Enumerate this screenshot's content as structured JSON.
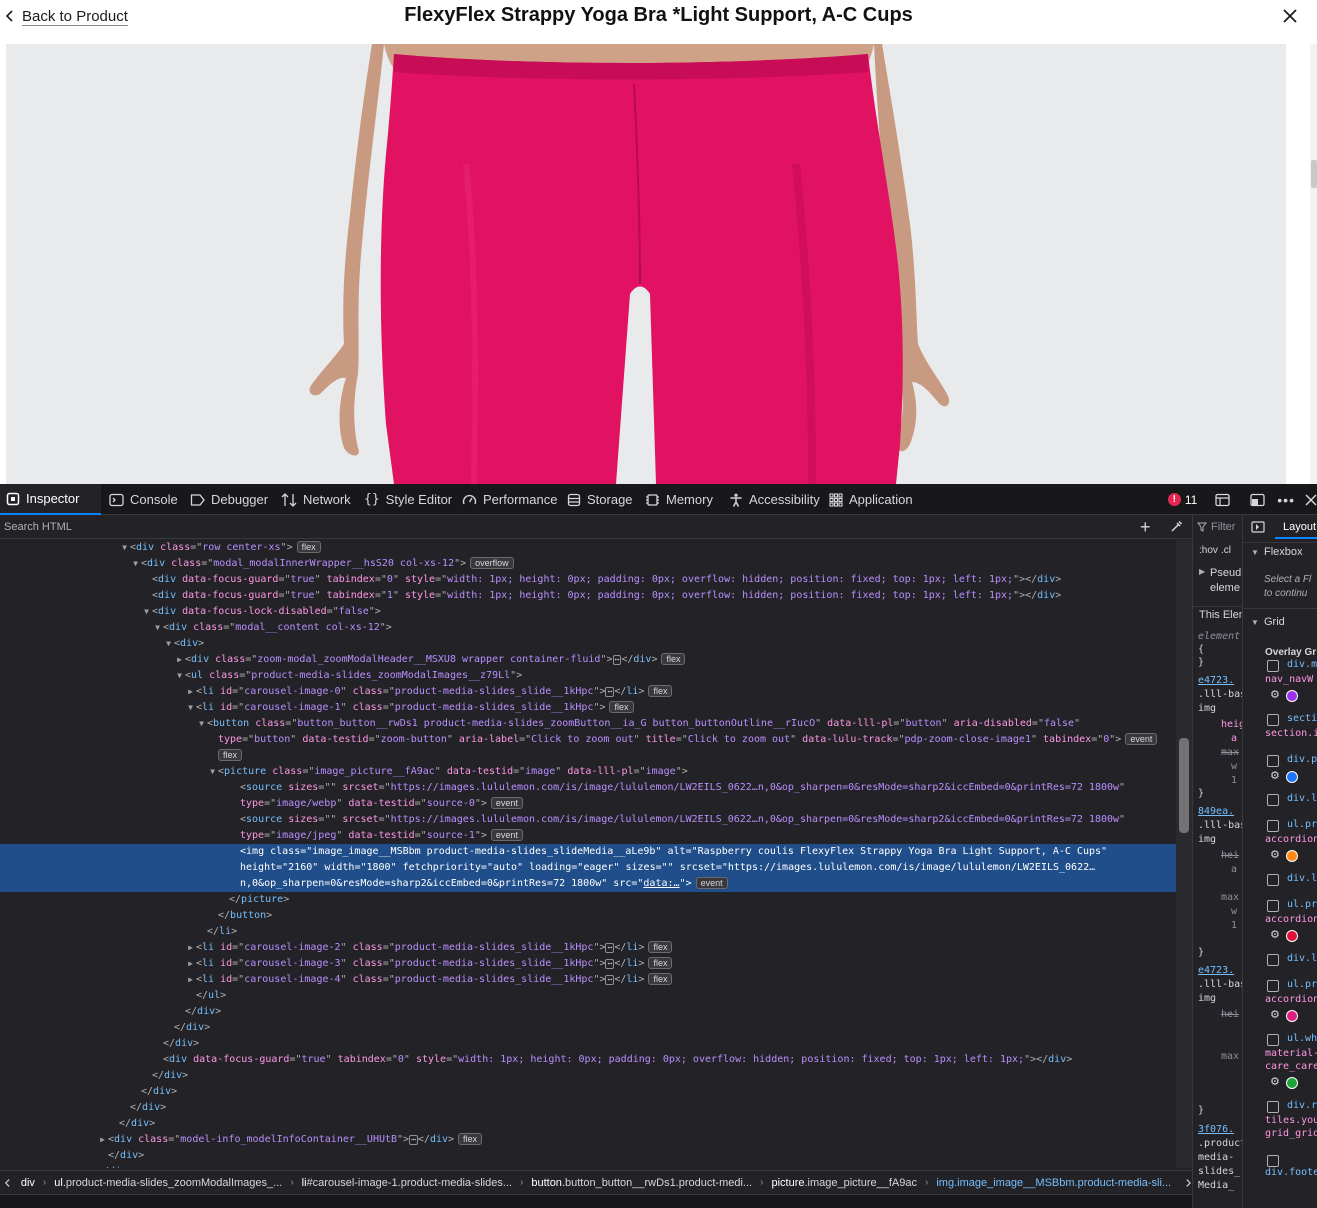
{
  "modal": {
    "back_label": "Back to Product",
    "title": "FlexyFlex Strappy Yoga Bra *Light Support, A-C Cups"
  },
  "devtools": {
    "tabs": [
      {
        "label": "Inspector",
        "icon": "inspector-icon",
        "active": true
      },
      {
        "label": "Console",
        "icon": "console-icon"
      },
      {
        "label": "Debugger",
        "icon": "debugger-icon"
      },
      {
        "label": "Network",
        "icon": "network-icon"
      },
      {
        "label": "Style Editor",
        "icon": "style-editor-icon"
      },
      {
        "label": "Performance",
        "icon": "performance-icon"
      },
      {
        "label": "Storage",
        "icon": "storage-icon"
      },
      {
        "label": "Memory",
        "icon": "memory-icon"
      },
      {
        "label": "Accessibility",
        "icon": "accessibility-icon"
      },
      {
        "label": "Application",
        "icon": "application-icon"
      }
    ],
    "error_count": "11",
    "search_placeholder": "Search HTML",
    "breadcrumbs": [
      {
        "tag": "div",
        "rest": ""
      },
      {
        "tag": "ul",
        "rest": ".product-media-slides_zoomModalImages_..."
      },
      {
        "tag": "li",
        "rest": "#carousel-image-1.product-media-slides..."
      },
      {
        "tag": "button",
        "rest": ".button_button__rwDs1.product-medi..."
      },
      {
        "tag": "picture",
        "rest": ".image_picture__fA9ac"
      },
      {
        "tag": "img",
        "rest": ".image_image__MSBbm.product-media-sli..."
      }
    ],
    "rules": {
      "filter_label": "Filter",
      "hov": ":hov",
      "cls": ".cl",
      "pseudo1": "Pseud",
      "pseudo2": "eleme",
      "this_element": "This Elem",
      "element_label": "element",
      "open_brace": "{",
      "close_brace": "}",
      "link1": "e4723.",
      "sel1a": ".lll-bas",
      "sel1b": "img",
      "p_heig": "heig",
      "p_a": "a",
      "p_max": "max",
      "p_w": "w",
      "p_1": "1",
      "link2": "849ea.",
      "sel2a": ".lll-bas",
      "sel2b": "img",
      "p_hei": "hei",
      "link3": "e4723.",
      "sel3a": ".lll-bas",
      "sel3b": "img",
      "link4": "3f076.",
      "sel4a": ".product",
      "sel4b": "media-",
      "sel4c": "slides_",
      "sel4d": "Media_"
    },
    "layout": {
      "tab_label": "Layout",
      "flexbox_label": "Flexbox",
      "flexbox_hint1": "Select a Fl",
      "flexbox_hint2": "to continu",
      "grid_label": "Grid",
      "overlay_label": "Overlay Gr",
      "grids": [
        {
          "name": "div.m",
          "sub": "nav_navW",
          "color": "#9b30f0"
        },
        {
          "name": "secti",
          "sub": "section.i",
          "color": ""
        },
        {
          "name": "div.p",
          "sub": "",
          "color": "#1f75ff"
        },
        {
          "name": "div.l",
          "sub": "",
          "color": ""
        },
        {
          "name": "ul.pr",
          "sub": "accordion",
          "color": "#ff8a1a"
        },
        {
          "name": "div.l",
          "sub": "",
          "color": ""
        },
        {
          "name": "ul.pr",
          "sub": "accordion",
          "color": "#e0123a"
        },
        {
          "name": "div.l",
          "sub": "",
          "color": ""
        },
        {
          "name": "ul.pr",
          "sub": "accordion",
          "color": "#e0207e"
        },
        {
          "name": "ul.wh",
          "sub": "material-",
          "sub2": "care_care",
          "color": "#1fa33a"
        },
        {
          "name": "div.r",
          "sub": "tiles.you",
          "sub2": "grid_grid",
          "color": ""
        },
        {
          "name": "",
          "sub": "div.foote",
          "color": ""
        }
      ]
    },
    "markup_lines": [
      {
        "indent": 130,
        "tw": "open",
        "html": "<span class='pun'>&lt;</span><span class='tg'>div</span> <span class='an'>class</span><span class='pun'>=\"</span><span class='av'>row center-xs</span><span class='pun'>\"&gt;</span><span class='badge'>flex</span>"
      },
      {
        "indent": 141,
        "tw": "open",
        "html": "<span class='pun'>&lt;</span><span class='tg'>div</span> <span class='an'>class</span><span class='pun'>=\"</span><span class='av'>modal_modalInnerWrapper__hsS20 col-xs-12</span><span class='pun'>\"&gt;</span><span class='badge'>overflow</span>"
      },
      {
        "indent": 152,
        "tw": "",
        "html": "<span class='pun'>&lt;</span><span class='tg'>div</span> <span class='an'>data-focus-guard</span><span class='pun'>=\"</span><span class='av'>true</span><span class='pun'>\"</span> <span class='an'>tabindex</span><span class='pun'>=\"</span><span class='av'>0</span><span class='pun'>\"</span> <span class='an'>style</span><span class='pun'>=\"</span><span class='av'>width: 1px; height: 0px; padding: 0px; overflow: hidden; position: fixed; top: 1px; left: 1px;</span><span class='pun'>\"&gt;&lt;/</span><span class='tg'>div</span><span class='pun'>&gt;</span>"
      },
      {
        "indent": 152,
        "tw": "",
        "html": "<span class='pun'>&lt;</span><span class='tg'>div</span> <span class='an'>data-focus-guard</span><span class='pun'>=\"</span><span class='av'>true</span><span class='pun'>\"</span> <span class='an'>tabindex</span><span class='pun'>=\"</span><span class='av'>1</span><span class='pun'>\"</span> <span class='an'>style</span><span class='pun'>=\"</span><span class='av'>width: 1px; height: 0px; padding: 0px; overflow: hidden; position: fixed; top: 1px; left: 1px;</span><span class='pun'>\"&gt;&lt;/</span><span class='tg'>div</span><span class='pun'>&gt;</span>"
      },
      {
        "indent": 152,
        "tw": "open",
        "html": "<span class='pun'>&lt;</span><span class='tg'>div</span> <span class='an'>data-focus-lock-disabled</span><span class='pun'>=\"</span><span class='av'>false</span><span class='pun'>\"&gt;</span>"
      },
      {
        "indent": 163,
        "tw": "open",
        "html": "<span class='pun'>&lt;</span><span class='tg'>div</span> <span class='an'>class</span><span class='pun'>=\"</span><span class='av'>modal__content col-xs-12</span><span class='pun'>\"&gt;</span>"
      },
      {
        "indent": 174,
        "tw": "open",
        "html": "<span class='pun'>&lt;</span><span class='tg'>div</span><span class='pun'>&gt;</span>"
      },
      {
        "indent": 185,
        "tw": "closed",
        "html": "<span class='pun'>&lt;</span><span class='tg'>div</span> <span class='an'>class</span><span class='pun'>=\"</span><span class='av'>zoom-modal_zoomModalHeader__MSXU8 wrapper container-fluid</span><span class='pun'>\"&gt;</span><span class='ell'>⋯</span><span class='pun'>&lt;/</span><span class='tg'>div</span><span class='pun'>&gt;</span><span class='badge'>flex</span>"
      },
      {
        "indent": 185,
        "tw": "open",
        "html": "<span class='pun'>&lt;</span><span class='tg'>ul</span> <span class='an'>class</span><span class='pun'>=\"</span><span class='av'>product-media-slides_zoomModalImages__z79Ll</span><span class='pun'>\"&gt;</span>"
      },
      {
        "indent": 196,
        "tw": "closed",
        "html": "<span class='pun'>&lt;</span><span class='tg'>li</span> <span class='an'>id</span><span class='pun'>=\"</span><span class='av'>carousel-image-0</span><span class='pun'>\"</span> <span class='an'>class</span><span class='pun'>=\"</span><span class='av'>product-media-slides_slide__1kHpc</span><span class='pun'>\"&gt;</span><span class='ell'>⋯</span><span class='pun'>&lt;/</span><span class='tg'>li</span><span class='pun'>&gt;</span><span class='badge'>flex</span>"
      },
      {
        "indent": 196,
        "tw": "open",
        "html": "<span class='pun'>&lt;</span><span class='tg'>li</span> <span class='an'>id</span><span class='pun'>=\"</span><span class='av'>carousel-image-1</span><span class='pun'>\"</span> <span class='an'>class</span><span class='pun'>=\"</span><span class='av'>product-media-slides_slide__1kHpc</span><span class='pun'>\"&gt;</span><span class='badge'>flex</span>"
      },
      {
        "indent": 207,
        "tw": "open",
        "html": "<span class='pun'>&lt;</span><span class='tg'>button</span> <span class='an'>class</span><span class='pun'>=\"</span><span class='av'>button_button__rwDs1 product-media-slides_zoomButton__ia_G button_buttonOutline__rIucO</span><span class='pun'>\"</span> <span class='an'>data-lll-pl</span><span class='pun'>=\"</span><span class='av'>button</span><span class='pun'>\"</span> <span class='an'>aria-disabled</span><span class='pun'>=\"</span><span class='av'>false</span><span class='pun'>\"</span>"
      },
      {
        "indent": 218,
        "tw": "",
        "html": "<span class='an'>type</span><span class='pun'>=\"</span><span class='av'>button</span><span class='pun'>\"</span> <span class='an'>data-testid</span><span class='pun'>=\"</span><span class='av'>zoom-button</span><span class='pun'>\"</span> <span class='an'>aria-label</span><span class='pun'>=\"</span><span class='av'>Click to zoom out</span><span class='pun'>\"</span> <span class='an'>title</span><span class='pun'>=\"</span><span class='av'>Click to zoom out</span><span class='pun'>\"</span> <span class='an'>data-lulu-track</span><span class='pun'>=\"</span><span class='av'>pdp-zoom-close-image1</span><span class='pun'>\"</span> <span class='an'>tabindex</span><span class='pun'>=\"</span><span class='av'>0</span><span class='pun'>\"&gt;</span><span class='badge'>event</span>"
      },
      {
        "indent": 218,
        "tw": "",
        "html": "<span class='badge' style='margin-left:0'>flex</span>"
      },
      {
        "indent": 218,
        "tw": "open",
        "html": "<span class='pun'>&lt;</span><span class='tg'>picture</span> <span class='an'>class</span><span class='pun'>=\"</span><span class='av'>image_picture__fA9ac</span><span class='pun'>\"</span> <span class='an'>data-testid</span><span class='pun'>=\"</span><span class='av'>image</span><span class='pun'>\"</span> <span class='an'>data-lll-pl</span><span class='pun'>=\"</span><span class='av'>image</span><span class='pun'>\"&gt;</span>"
      },
      {
        "indent": 240,
        "tw": "",
        "html": "<span class='pun'>&lt;</span><span class='tg'>source</span> <span class='an'>sizes</span><span class='pun'>=\"\"</span> <span class='an'>srcset</span><span class='pun'>=\"</span><span class='av'>https://images.lululemon.com/is/image/lululemon/LW2EILS_0622…n,0&amp;op_sharpen=0&amp;resMode=sharp2&amp;iccEmbed=0&amp;printRes=72 1800w</span><span class='pun'>\"</span>"
      },
      {
        "indent": 240,
        "tw": "",
        "html": "<span class='an'>type</span><span class='pun'>=\"</span><span class='av'>image/webp</span><span class='pun'>\"</span> <span class='an'>data-testid</span><span class='pun'>=\"</span><span class='av'>source-0</span><span class='pun'>\"&gt;</span><span class='badge'>event</span>"
      },
      {
        "indent": 240,
        "tw": "",
        "html": "<span class='pun'>&lt;</span><span class='tg'>source</span> <span class='an'>sizes</span><span class='pun'>=\"\"</span> <span class='an'>srcset</span><span class='pun'>=\"</span><span class='av'>https://images.lululemon.com/is/image/lululemon/LW2EILS_0622…n,0&amp;op_sharpen=0&amp;resMode=sharp2&amp;iccEmbed=0&amp;printRes=72 1800w</span><span class='pun'>\"</span>"
      },
      {
        "indent": 240,
        "tw": "",
        "html": "<span class='an'>type</span><span class='pun'>=\"</span><span class='av'>image/jpeg</span><span class='pun'>\"</span> <span class='an'>data-testid</span><span class='pun'>=\"</span><span class='av'>source-1</span><span class='pun'>\"&gt;</span><span class='badge'>event</span>"
      },
      {
        "indent": 240,
        "tw": "",
        "sel": true,
        "html": "<span class='pun'>&lt;</span><span class='tg'>img</span> <span class='an'>class</span><span class='pun'>=\"</span><span class='av'>image_image__MSBbm product-media-slides_slideMedia__aLe9b</span><span class='pun'>\"</span> <span class='an'>alt</span><span class='pun'>=\"</span><span class='av'>Raspberry coulis FlexyFlex Strappy Yoga Bra Light Support, A-C Cups</span><span class='pun'>\"</span>"
      },
      {
        "indent": 240,
        "tw": "",
        "sel": true,
        "html": "<span class='an'>height</span><span class='pun'>=\"</span><span class='av'>2160</span><span class='pun'>\"</span> <span class='an'>width</span><span class='pun'>=\"</span><span class='av'>1800</span><span class='pun'>\"</span> <span class='an'>fetchpriority</span><span class='pun'>=\"</span><span class='av'>auto</span><span class='pun'>\"</span> <span class='an'>loading</span><span class='pun'>=\"</span><span class='av'>eager</span><span class='pun'>\"</span> <span class='an'>sizes</span><span class='pun'>=\"\"</span> <span class='an'>srcset</span><span class='pun'>=\"</span><span class='av'>https://images.lululemon.com/is/image/lululemon/LW2EILS_0622…</span>"
      },
      {
        "indent": 240,
        "tw": "",
        "sel": true,
        "html": "<span class='av'>n,0&amp;op_sharpen=0&amp;resMode=sharp2&amp;iccEmbed=0&amp;printRes=72 1800w</span><span class='pun'>\"</span> <span class='an'>src</span><span class='pun'>=\"</span><span class='av' style='text-decoration:underline'>data:…</span><span class='pun'>\"&gt;</span><span class='badge'>event</span>"
      },
      {
        "indent": 229,
        "tw": "",
        "html": "<span class='pun'>&lt;/</span><span class='tg'>picture</span><span class='pun'>&gt;</span>"
      },
      {
        "indent": 218,
        "tw": "",
        "html": "<span class='pun'>&lt;/</span><span class='tg'>button</span><span class='pun'>&gt;</span>"
      },
      {
        "indent": 207,
        "tw": "",
        "html": "<span class='pun'>&lt;/</span><span class='tg'>li</span><span class='pun'>&gt;</span>"
      },
      {
        "indent": 196,
        "tw": "closed",
        "html": "<span class='pun'>&lt;</span><span class='tg'>li</span> <span class='an'>id</span><span class='pun'>=\"</span><span class='av'>carousel-image-2</span><span class='pun'>\"</span> <span class='an'>class</span><span class='pun'>=\"</span><span class='av'>product-media-slides_slide__1kHpc</span><span class='pun'>\"&gt;</span><span class='ell'>⋯</span><span class='pun'>&lt;/</span><span class='tg'>li</span><span class='pun'>&gt;</span><span class='badge'>flex</span>"
      },
      {
        "indent": 196,
        "tw": "closed",
        "html": "<span class='pun'>&lt;</span><span class='tg'>li</span> <span class='an'>id</span><span class='pun'>=\"</span><span class='av'>carousel-image-3</span><span class='pun'>\"</span> <span class='an'>class</span><span class='pun'>=\"</span><span class='av'>product-media-slides_slide__1kHpc</span><span class='pun'>\"&gt;</span><span class='ell'>⋯</span><span class='pun'>&lt;/</span><span class='tg'>li</span><span class='pun'>&gt;</span><span class='badge'>flex</span>"
      },
      {
        "indent": 196,
        "tw": "closed",
        "html": "<span class='pun'>&lt;</span><span class='tg'>li</span> <span class='an'>id</span><span class='pun'>=\"</span><span class='av'>carousel-image-4</span><span class='pun'>\"</span> <span class='an'>class</span><span class='pun'>=\"</span><span class='av'>product-media-slides_slide__1kHpc</span><span class='pun'>\"&gt;</span><span class='ell'>⋯</span><span class='pun'>&lt;/</span><span class='tg'>li</span><span class='pun'>&gt;</span><span class='badge'>flex</span>"
      },
      {
        "indent": 196,
        "tw": "",
        "html": "<span class='pun'>&lt;/</span><span class='tg'>ul</span><span class='pun'>&gt;</span>"
      },
      {
        "indent": 185,
        "tw": "",
        "html": "<span class='pun'>&lt;/</span><span class='tg'>div</span><span class='pun'>&gt;</span>"
      },
      {
        "indent": 174,
        "tw": "",
        "html": "<span class='pun'>&lt;/</span><span class='tg'>div</span><span class='pun'>&gt;</span>"
      },
      {
        "indent": 163,
        "tw": "",
        "html": "<span class='pun'>&lt;/</span><span class='tg'>div</span><span class='pun'>&gt;</span>"
      },
      {
        "indent": 163,
        "tw": "",
        "html": "<span class='pun'>&lt;</span><span class='tg'>div</span> <span class='an'>data-focus-guard</span><span class='pun'>=\"</span><span class='av'>true</span><span class='pun'>\"</span> <span class='an'>tabindex</span><span class='pun'>=\"</span><span class='av'>0</span><span class='pun'>\"</span> <span class='an'>style</span><span class='pun'>=\"</span><span class='av'>width: 1px; height: 0px; padding: 0px; overflow: hidden; position: fixed; top: 1px; left: 1px;</span><span class='pun'>\"&gt;&lt;/</span><span class='tg'>div</span><span class='pun'>&gt;</span>"
      },
      {
        "indent": 152,
        "tw": "",
        "html": "<span class='pun'>&lt;/</span><span class='tg'>div</span><span class='pun'>&gt;</span>"
      },
      {
        "indent": 141,
        "tw": "",
        "html": "<span class='pun'>&lt;/</span><span class='tg'>div</span><span class='pun'>&gt;</span>"
      },
      {
        "indent": 130,
        "tw": "",
        "html": "<span class='pun'>&lt;/</span><span class='tg'>div</span><span class='pun'>&gt;</span>"
      },
      {
        "indent": 119,
        "tw": "",
        "html": "<span class='pun'>&lt;/</span><span class='tg'>div</span><span class='pun'>&gt;</span>"
      },
      {
        "indent": 108,
        "tw": "closed",
        "html": "<span class='pun'>&lt;</span><span class='tg'>div</span> <span class='an'>class</span><span class='pun'>=\"</span><span class='av'>model-info_modelInfoContainer__UHUtB</span><span class='pun'>\"&gt;</span><span class='ell'>⋯</span><span class='pun'>&lt;/</span><span class='tg'>div</span><span class='pun'>&gt;</span><span class='badge'>flex</span>"
      },
      {
        "indent": 108,
        "tw": "",
        "html": "<span class='pun'>&lt;/</span><span class='tg'>div</span><span class='pun'>&gt;</span>"
      },
      {
        "indent": 97,
        "tw": "",
        "html": "<span class='pun'>&lt;/</span><span class='tg'>div</span><span class='pun'>&gt;</span>"
      }
    ]
  }
}
